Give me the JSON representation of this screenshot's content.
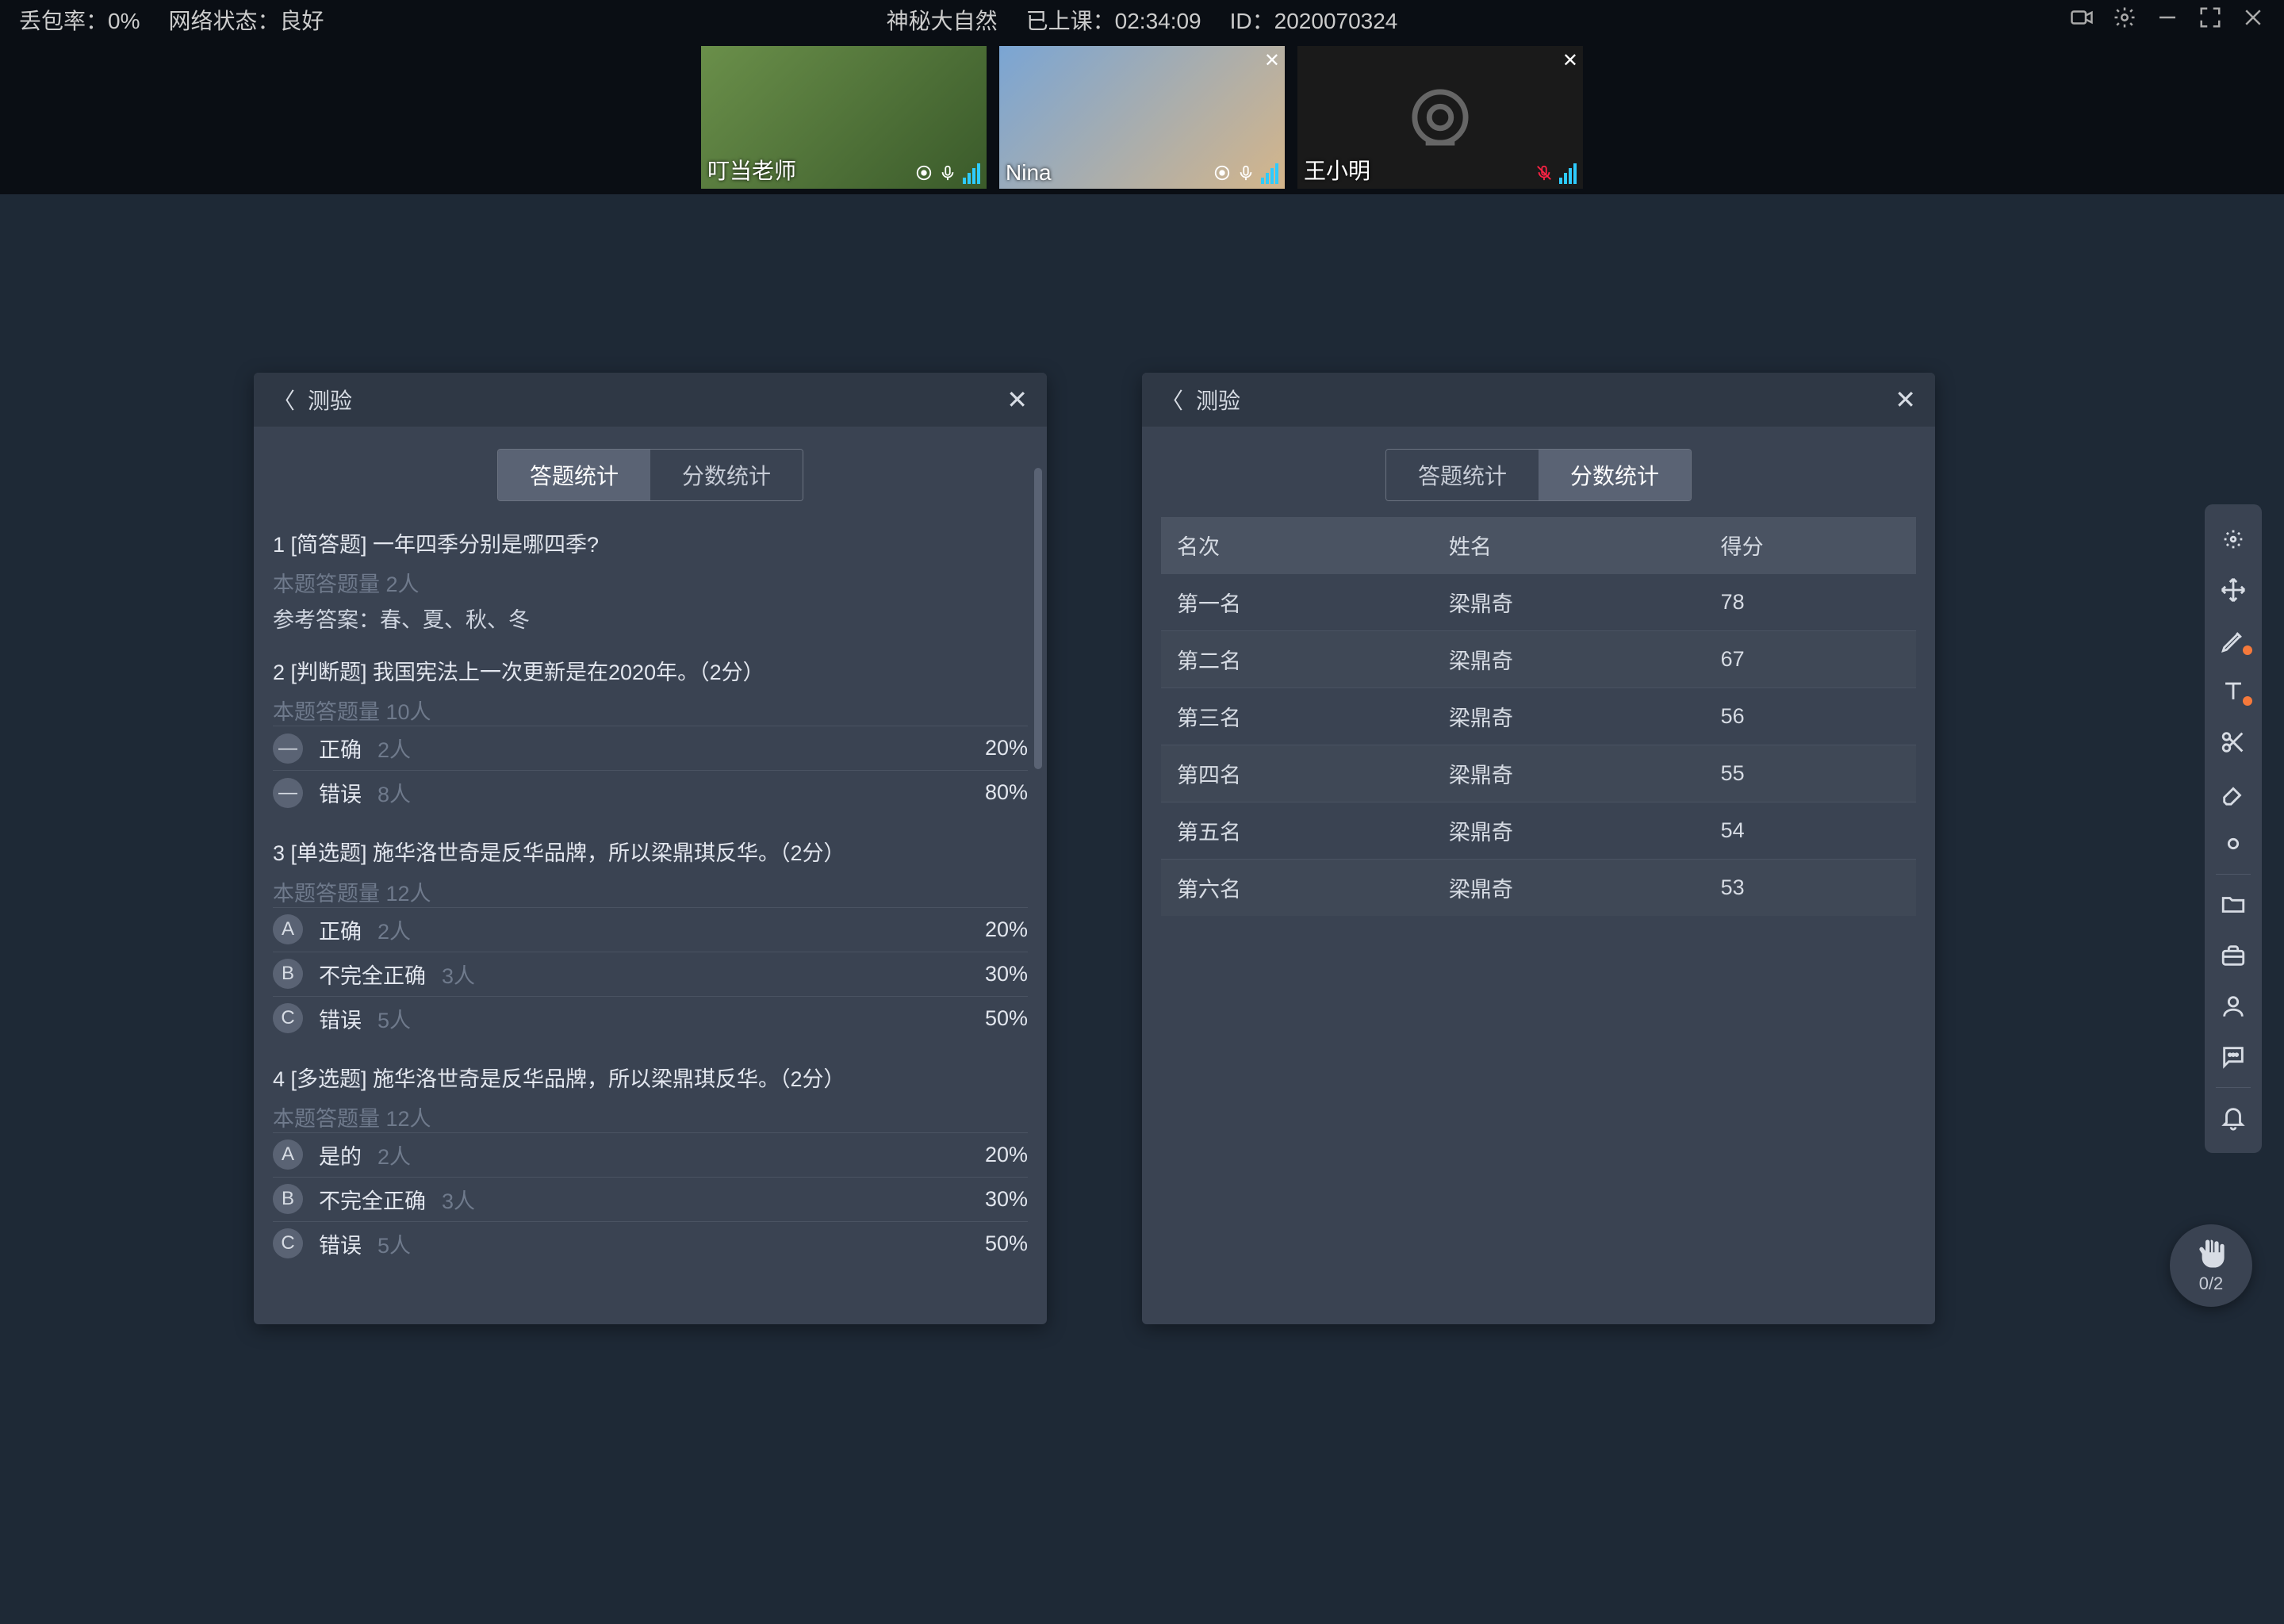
{
  "topbar": {
    "packet_loss_label": "丢包率：",
    "packet_loss_value": "0%",
    "network_label": "网络状态：",
    "network_value": "良好",
    "title": "神秘大自然",
    "duration_label": "已上课：",
    "duration_value": "02:34:09",
    "id_label": "ID：",
    "id_value": "2020070324"
  },
  "video_tiles": [
    {
      "name": "叮当老师",
      "closeable": false,
      "cam_off": false
    },
    {
      "name": "Nina",
      "closeable": true,
      "cam_off": false
    },
    {
      "name": "王小明",
      "closeable": true,
      "cam_off": true
    }
  ],
  "panels": {
    "title": "测验",
    "tabs": {
      "answer": "答题统计",
      "score": "分数统计"
    }
  },
  "questions": [
    {
      "title": "1 [简答题] 一年四季分别是哪四季?",
      "sub": "本题答题量 2人",
      "answer_label": "参考答案：",
      "answer": "春、夏、秋、冬",
      "options": null
    },
    {
      "title": "2 [判断题] 我国宪法上一次更新是在2020年。（2分）",
      "sub": "本题答题量 10人",
      "options": [
        {
          "letter": "—",
          "text": "正确",
          "count": "2人",
          "pct": "20%"
        },
        {
          "letter": "—",
          "text": "错误",
          "count": "8人",
          "pct": "80%"
        }
      ]
    },
    {
      "title": "3 [单选题] 施华洛世奇是反华品牌，所以梁鼎琪反华。（2分）",
      "sub": "本题答题量 12人",
      "options": [
        {
          "letter": "A",
          "text": "正确",
          "count": "2人",
          "pct": "20%"
        },
        {
          "letter": "B",
          "text": "不完全正确",
          "count": "3人",
          "pct": "30%"
        },
        {
          "letter": "C",
          "text": "错误",
          "count": "5人",
          "pct": "50%"
        }
      ]
    },
    {
      "title": "4 [多选题] 施华洛世奇是反华品牌，所以梁鼎琪反华。（2分）",
      "sub": "本题答题量 12人",
      "options": [
        {
          "letter": "A",
          "text": "是的",
          "count": "2人",
          "pct": "20%"
        },
        {
          "letter": "B",
          "text": "不完全正确",
          "count": "3人",
          "pct": "30%"
        },
        {
          "letter": "C",
          "text": "错误",
          "count": "5人",
          "pct": "50%"
        }
      ]
    }
  ],
  "score_table": {
    "headers": [
      "名次",
      "姓名",
      "得分"
    ],
    "rows": [
      [
        "第一名",
        "梁鼎奇",
        "78"
      ],
      [
        "第二名",
        "梁鼎奇",
        "67"
      ],
      [
        "第三名",
        "梁鼎奇",
        "56"
      ],
      [
        "第四名",
        "梁鼎奇",
        "55"
      ],
      [
        "第五名",
        "梁鼎奇",
        "54"
      ],
      [
        "第六名",
        "梁鼎奇",
        "53"
      ]
    ]
  },
  "sidebar_tools": [
    {
      "name": "laser-pointer-icon"
    },
    {
      "name": "move-icon"
    },
    {
      "name": "pen-icon",
      "dot": true
    },
    {
      "name": "text-tool-icon",
      "dot": true
    },
    {
      "name": "scissors-icon"
    },
    {
      "name": "eraser-icon"
    },
    {
      "name": "brightness-icon"
    },
    {
      "sep": true
    },
    {
      "name": "folder-icon"
    },
    {
      "name": "toolbox-icon"
    },
    {
      "name": "user-icon"
    },
    {
      "name": "chat-icon"
    },
    {
      "sep": true
    },
    {
      "name": "bell-icon"
    }
  ],
  "hand": {
    "count": "0/2"
  }
}
